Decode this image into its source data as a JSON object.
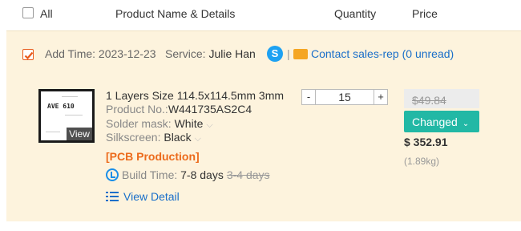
{
  "header": {
    "all_label": "All",
    "product_col": "Product Name & Details",
    "quantity_col": "Quantity",
    "price_col": "Price"
  },
  "order": {
    "add_time_label": "Add Time:",
    "add_time": "2023-12-23",
    "service_label": "Service:",
    "service_name": "Julie Han",
    "skype_glyph": "S",
    "separator": "|",
    "contact_label": "Contact sales-rep (0 unread)"
  },
  "product": {
    "thumb_title": "AVE 610",
    "view_label": "View",
    "name": "1 Layers Size 114.5x114.5mm 3mm",
    "product_no_label": "Product No.:",
    "product_no": "W441735AS2C4",
    "solder_label": "Solder mask:",
    "solder_value": "White",
    "silk_label": "Silkscreen:",
    "silk_value": "Black",
    "tag": "[PCB Production]",
    "build_label": "Build Time:",
    "build_value": "7-8 days",
    "build_old": "3-4 days",
    "detail_label": "View Detail"
  },
  "quantity": {
    "minus": "-",
    "value": "15",
    "plus": "+"
  },
  "price": {
    "old": "$49.84",
    "changed_label": "Changed",
    "new": "$ 352.91",
    "weight": "(1.89kg)"
  },
  "colors": {
    "accent_orange": "#ec6b1c",
    "link_blue": "#1a6fc9",
    "teal": "#22b8a5",
    "card_bg": "#fdf3dd"
  }
}
